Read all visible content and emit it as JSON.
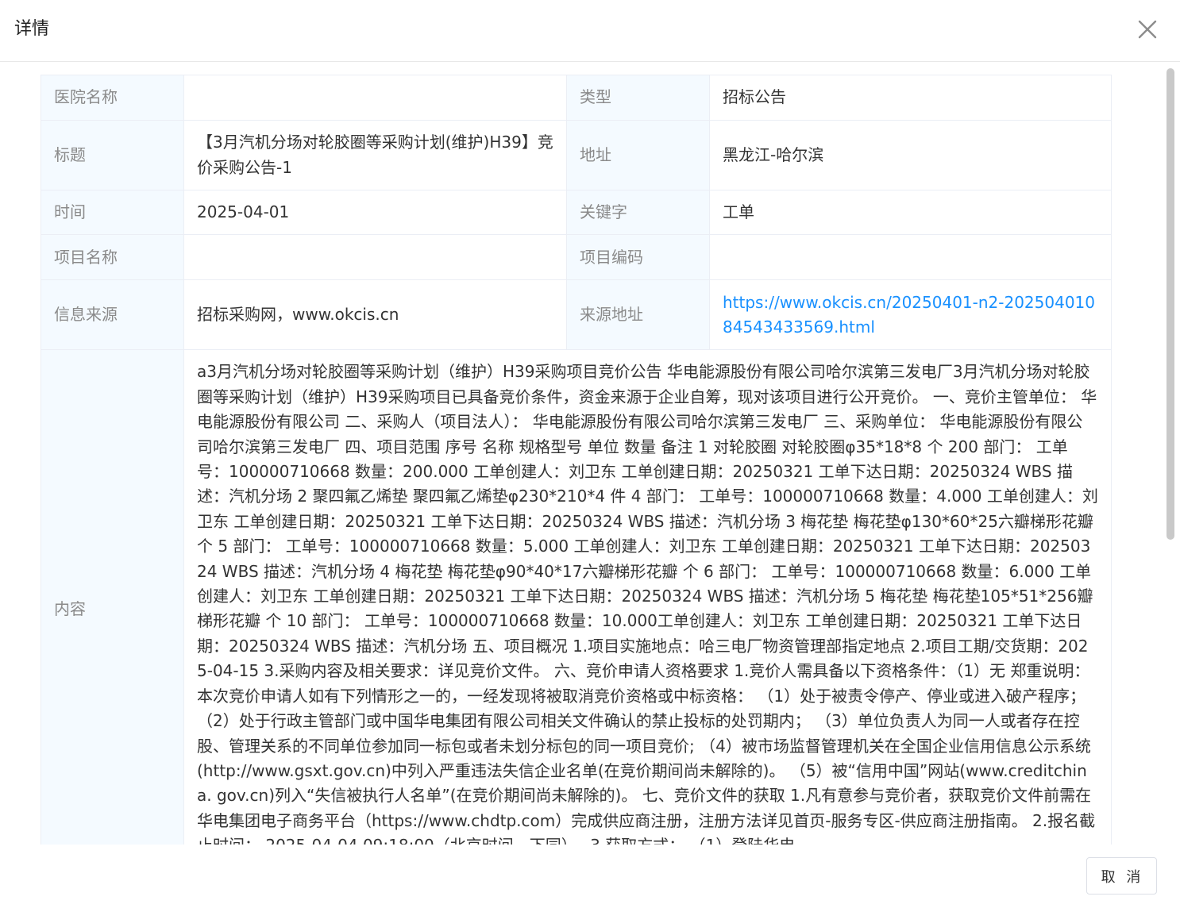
{
  "dialog": {
    "title": "详情",
    "close_icon": "close-icon",
    "cancel_label": "取 消"
  },
  "fields": {
    "hospital_label": "医院名称",
    "hospital_value": "",
    "type_label": "类型",
    "type_value": "招标公告",
    "title_label": "标题",
    "title_value": "【3月汽机分场对轮胶圈等采购计划(维护)H39】竞价采购公告-1",
    "address_label": "地址",
    "address_value": "黑龙江-哈尔滨",
    "time_label": "时间",
    "time_value": "2025-04-01",
    "keyword_label": "关键字",
    "keyword_value": "工单",
    "project_name_label": "项目名称",
    "project_name_value": "",
    "project_code_label": "项目编码",
    "project_code_value": "",
    "source_label": "信息来源",
    "source_value": "招标采购网，www.okcis.cn",
    "source_url_label": "来源地址",
    "source_url_value": "https://www.okcis.cn/20250401-n2-20250401084543433569.html",
    "content_label": "内容",
    "content_value": "a3月汽机分场对轮胶圈等采购计划（维护）H39采购项目竞价公告 华电能源股份有限公司哈尔滨第三发电厂3月汽机分场对轮胶圈等采购计划（维护）H39采购项目已具备竞价条件，资金来源于企业自筹，现对该项目进行公开竞价。 一、竞价主管单位： 华电能源股份有限公司 二、采购人（项目法人）： 华电能源股份有限公司哈尔滨第三发电厂 三、采购单位： 华电能源股份有限公司哈尔滨第三发电厂 四、项目范围 序号 名称 规格型号 单位 数量 备注 1 对轮胶圈 对轮胶圈φ35*18*8 个 200 部门： 工单号：100000710668 数量：200.000 工单创建人：刘卫东 工单创建日期：20250321 工单下达日期：20250324 WBS 描述：汽机分场 2 聚四氟乙烯垫 聚四氟乙烯垫φ230*210*4 件 4 部门： 工单号：100000710668 数量：4.000 工单创建人：刘卫东 工单创建日期：20250321 工单下达日期：20250324 WBS 描述：汽机分场 3 梅花垫 梅花垫φ130*60*25六瓣梯形花瓣 个 5 部门： 工单号：100000710668 数量：5.000 工单创建人：刘卫东 工单创建日期：20250321 工单下达日期：20250324 WBS 描述：汽机分场 4 梅花垫 梅花垫φ90*40*17六瓣梯形花瓣 个 6 部门： 工单号：100000710668 数量：6.000 工单创建人：刘卫东 工单创建日期：20250321 工单下达日期：20250324 WBS 描述：汽机分场 5 梅花垫 梅花垫105*51*256瓣梯形花瓣 个 10 部门： 工单号：100000710668 数量：10.000工单创建人：刘卫东 工单创建日期：20250321 工单下达日期：20250324 WBS 描述：汽机分场 五、项目概况 1.项目实施地点：哈三电厂物资管理部指定地点 2.项目工期/交货期：2025-04-15 3.采购内容及相关要求：详见竞价文件。 六、竞价申请人资格要求 1.竞价人需具备以下资格条件：（1）无 郑重说明：本次竞价申请人如有下列情形之一的，一经发现将被取消竞价资格或中标资格： （1）处于被责令停产、停业或进入破产程序； （2）处于行政主管部门或中国华电集团有限公司相关文件确认的禁止投标的处罚期内； （3）单位负责人为同一人或者存在控股、管理关系的不同单位参加同一标包或者未划分标包的同一项目竞价; （4）被市场监督管理机关在全国企业信用信息公示系统(http://www.gsxt.gov.cn)中列入严重违法失信企业名单(在竞价期间尚未解除的)。 （5）被“信用中国”网站(www.creditchina. gov.cn)列入“失信被执行人名单”(在竞价期间尚未解除的)。 七、竞价文件的获取 1.凡有意参与竞价者，获取竞价文件前需在华电集团电子商务平台（https://www.chdtp.com）完成供应商注册，注册方法详见首页-服务专区-供应商注册指南。 2.报名截止时间： 2025-04-04 09:18:00（北京时间，下同）。 3.获取方式： （1）登陆华电"
  }
}
